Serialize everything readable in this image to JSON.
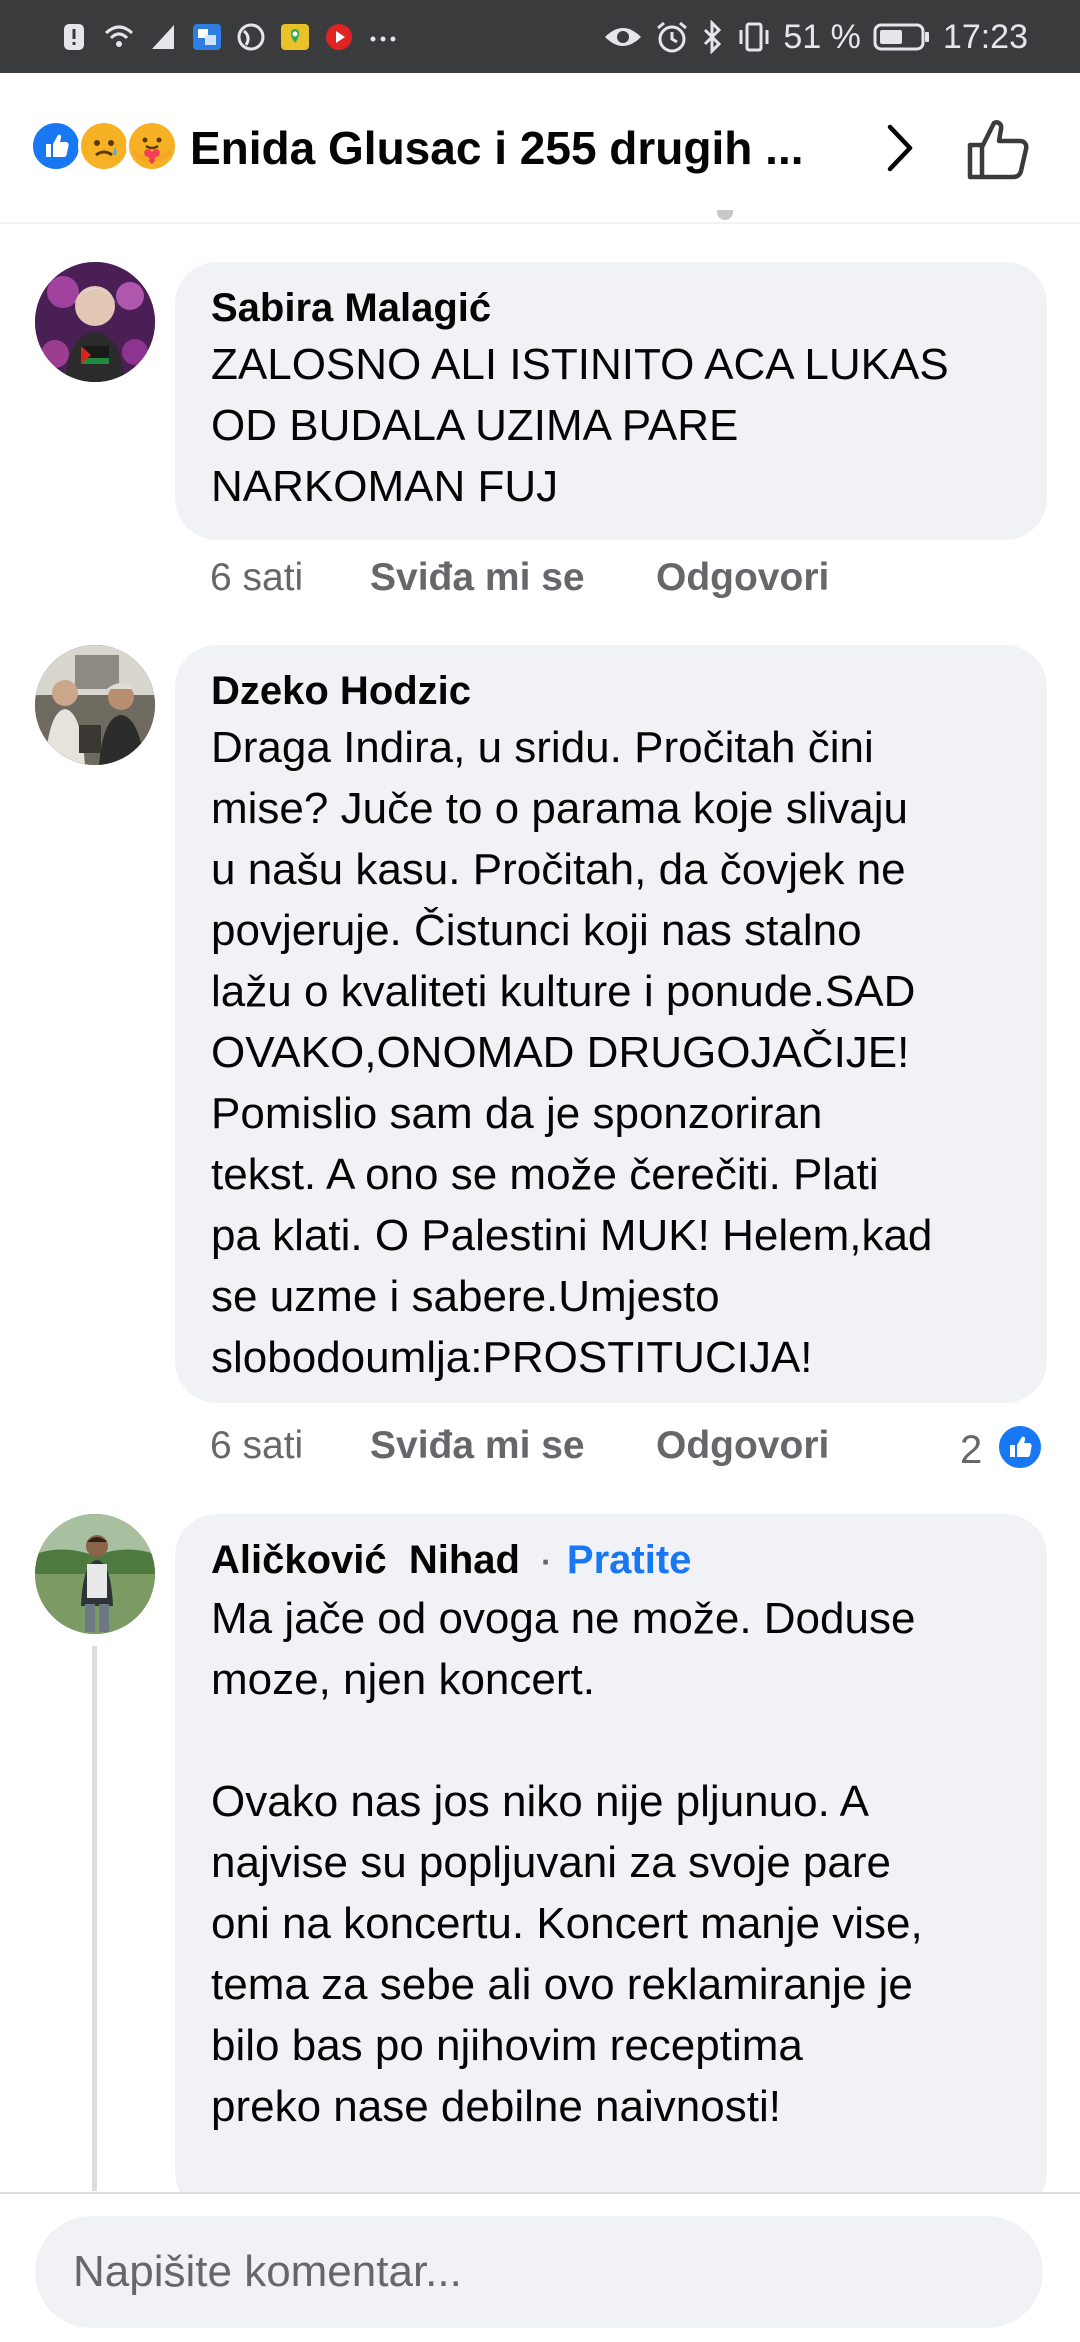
{
  "status_bar": {
    "battery_percent": "51 %",
    "time": "17:23",
    "icons": [
      "alert-icon",
      "wifi-icon",
      "signal-icon",
      "translate-app-icon",
      "vpn-icon",
      "maps-icon",
      "youtube-icon",
      "more-dots-icon",
      "eye-icon",
      "alarm-icon",
      "bluetooth-icon",
      "vibrate-icon",
      "battery-icon"
    ]
  },
  "header": {
    "reactions": [
      "like-reaction-icon",
      "sad-reaction-icon",
      "care-reaction-icon"
    ],
    "title": "Enida Glusac i 255 drugih ...",
    "colors": {
      "like_blue": "#1877f2",
      "reaction_yellow": "#f7b125"
    }
  },
  "comments": [
    {
      "author": "Sabira Malagić",
      "text": "ZALOSNO ALI ISTINITO ACA LUKAS\nOD BUDALA UZIMA PARE\nNARKOMAN FUJ",
      "time": "6 sati",
      "like_label": "Sviđa mi se",
      "reply_label": "Odgovori"
    },
    {
      "author": "Dzeko Hodzic",
      "text": "Draga Indira, u sridu. Pročitah čini\nmise? Juče to o parama koje slivaju\nu našu kasu. Pročitah, da čovjek ne\npovjeruje. Čistunci koji nas stalno\nlažu o kvaliteti kulture i ponude.SAD\nOVAKO,ONOMAD DRUGOJAČIJE!\nPomislio sam da je sponzoriran\ntekst. A ono se može čerečiti. Plati\npa klati. O Palestini MUK! Helem,kad\nse uzme i sabere.Umjesto\nslobodoumlja:PROSTITUCIJA!",
      "time": "6 sati",
      "like_label": "Sviđa mi se",
      "reply_label": "Odgovori",
      "like_count": "2"
    },
    {
      "author": "Aličković  Nihad",
      "separator": "·",
      "follow_label": "Pratite",
      "text": "Ma jače od ovoga ne može. Doduse\nmoze, njen koncert.\n\nOvako nas jos niko nije pljunuo. A\nnajvise su popljuvani za svoje pare\noni na koncertu. Koncert manje vise,\ntema za sebe ali ovo reklamiranje je\nbilo bas po njihovim receptima\npreko nase debilne naivnosti!"
    }
  ],
  "composer": {
    "placeholder": "Napišite komentar..."
  }
}
